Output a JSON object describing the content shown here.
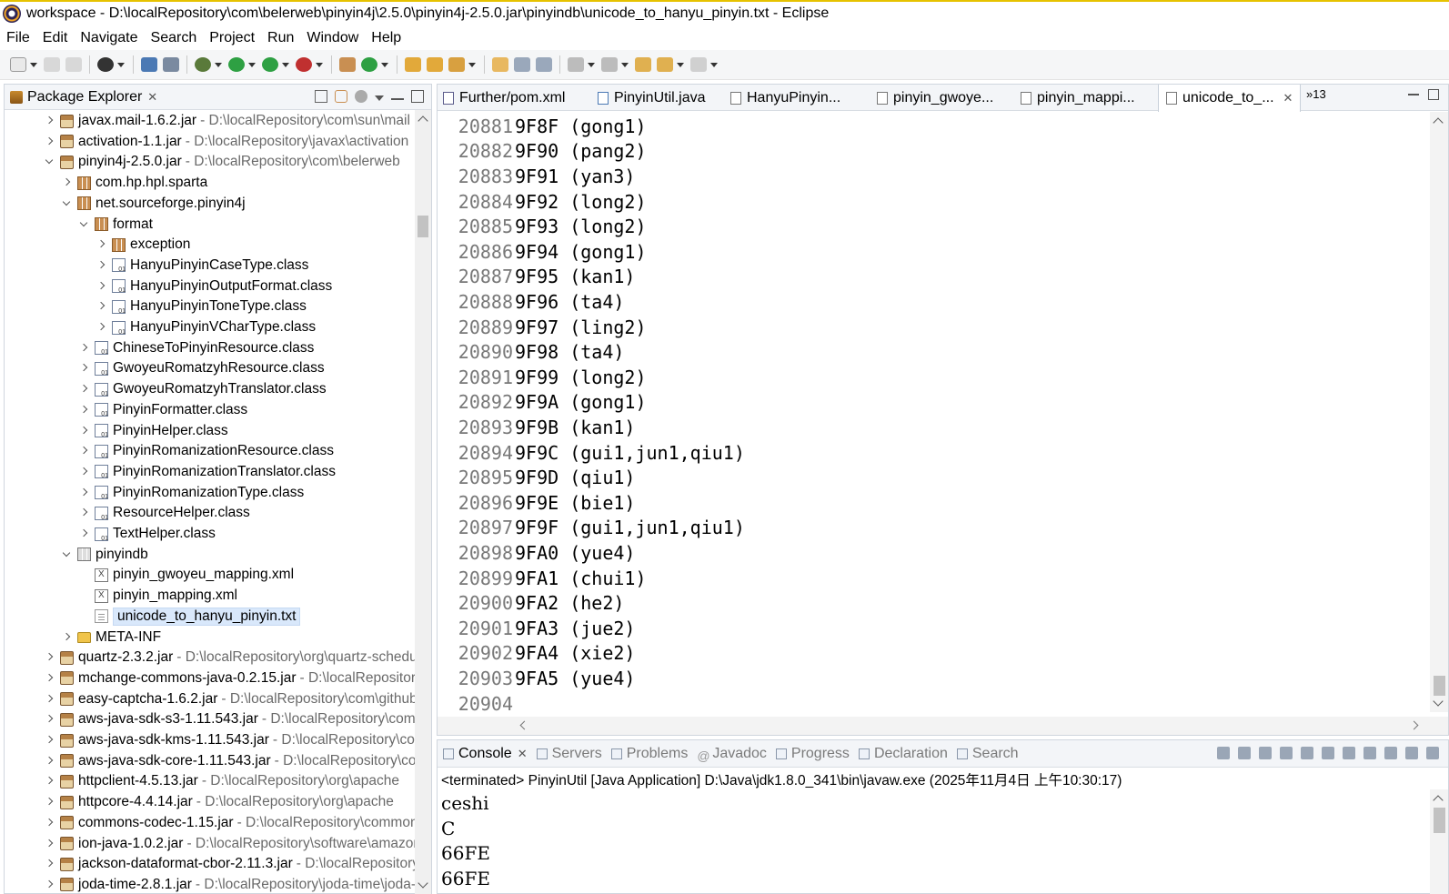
{
  "window": {
    "title": "workspace - D:\\localRepository\\com\\belerweb\\pinyin4j\\2.5.0\\pinyin4j-2.5.0.jar\\pinyindb\\unicode_to_hanyu_pinyin.txt - Eclipse"
  },
  "menu": [
    "File",
    "Edit",
    "Navigate",
    "Search",
    "Project",
    "Run",
    "Window",
    "Help"
  ],
  "package_explorer": {
    "title": "Package Explorer",
    "close": "✕",
    "rows": [
      {
        "indent": 0,
        "arrow": "right",
        "icon": "jar",
        "label": "javax.mail-1.6.2.jar",
        "path": "- D:\\localRepository\\com\\sun\\mail"
      },
      {
        "indent": 0,
        "arrow": "right",
        "icon": "jar",
        "label": "activation-1.1.jar",
        "path": "- D:\\localRepository\\javax\\activation"
      },
      {
        "indent": 0,
        "arrow": "down",
        "icon": "jar",
        "label": "pinyin4j-2.5.0.jar",
        "path": "- D:\\localRepository\\com\\belerweb"
      },
      {
        "indent": 1,
        "arrow": "right",
        "icon": "pkg",
        "label": "com.hp.hpl.sparta",
        "path": ""
      },
      {
        "indent": 1,
        "arrow": "down",
        "icon": "pkg",
        "label": "net.sourceforge.pinyin4j",
        "path": ""
      },
      {
        "indent": 2,
        "arrow": "down",
        "icon": "pkg",
        "label": "format",
        "path": ""
      },
      {
        "indent": 3,
        "arrow": "right",
        "icon": "pkg",
        "label": "exception",
        "path": ""
      },
      {
        "indent": 3,
        "arrow": "right",
        "icon": "cls",
        "label": "HanyuPinyinCaseType.class",
        "path": ""
      },
      {
        "indent": 3,
        "arrow": "right",
        "icon": "cls",
        "label": "HanyuPinyinOutputFormat.class",
        "path": ""
      },
      {
        "indent": 3,
        "arrow": "right",
        "icon": "cls",
        "label": "HanyuPinyinToneType.class",
        "path": ""
      },
      {
        "indent": 3,
        "arrow": "right",
        "icon": "cls",
        "label": "HanyuPinyinVCharType.class",
        "path": ""
      },
      {
        "indent": 2,
        "arrow": "right",
        "icon": "cls",
        "label": "ChineseToPinyinResource.class",
        "path": ""
      },
      {
        "indent": 2,
        "arrow": "right",
        "icon": "cls",
        "label": "GwoyeuRomatzyhResource.class",
        "path": ""
      },
      {
        "indent": 2,
        "arrow": "right",
        "icon": "cls",
        "label": "GwoyeuRomatzyhTranslator.class",
        "path": ""
      },
      {
        "indent": 2,
        "arrow": "right",
        "icon": "cls",
        "label": "PinyinFormatter.class",
        "path": ""
      },
      {
        "indent": 2,
        "arrow": "right",
        "icon": "cls",
        "label": "PinyinHelper.class",
        "path": ""
      },
      {
        "indent": 2,
        "arrow": "right",
        "icon": "cls",
        "label": "PinyinRomanizationResource.class",
        "path": ""
      },
      {
        "indent": 2,
        "arrow": "right",
        "icon": "cls",
        "label": "PinyinRomanizationTranslator.class",
        "path": ""
      },
      {
        "indent": 2,
        "arrow": "right",
        "icon": "cls",
        "label": "PinyinRomanizationType.class",
        "path": ""
      },
      {
        "indent": 2,
        "arrow": "right",
        "icon": "cls",
        "label": "ResourceHelper.class",
        "path": ""
      },
      {
        "indent": 2,
        "arrow": "right",
        "icon": "cls",
        "label": "TextHelper.class",
        "path": ""
      },
      {
        "indent": 1,
        "arrow": "down",
        "icon": "pkgfolder",
        "label": "pinyindb",
        "path": ""
      },
      {
        "indent": 2,
        "arrow": "none",
        "icon": "xml",
        "label": "pinyin_gwoyeu_mapping.xml",
        "path": ""
      },
      {
        "indent": 2,
        "arrow": "none",
        "icon": "xml",
        "label": "pinyin_mapping.xml",
        "path": ""
      },
      {
        "indent": 2,
        "arrow": "none",
        "icon": "txt",
        "label": "unicode_to_hanyu_pinyin.txt",
        "path": "",
        "selected": true
      },
      {
        "indent": 1,
        "arrow": "right",
        "icon": "folder",
        "label": "META-INF",
        "path": ""
      },
      {
        "indent": 0,
        "arrow": "right",
        "icon": "jar",
        "label": "quartz-2.3.2.jar",
        "path": "- D:\\localRepository\\org\\quartz-scheduler"
      },
      {
        "indent": 0,
        "arrow": "right",
        "icon": "jar",
        "label": "mchange-commons-java-0.2.15.jar",
        "path": "- D:\\localRepository"
      },
      {
        "indent": 0,
        "arrow": "right",
        "icon": "jar",
        "label": "easy-captcha-1.6.2.jar",
        "path": "- D:\\localRepository\\com\\github"
      },
      {
        "indent": 0,
        "arrow": "right",
        "icon": "jar",
        "label": "aws-java-sdk-s3-1.11.543.jar",
        "path": "- D:\\localRepository\\com"
      },
      {
        "indent": 0,
        "arrow": "right",
        "icon": "jar",
        "label": "aws-java-sdk-kms-1.11.543.jar",
        "path": "- D:\\localRepository\\com"
      },
      {
        "indent": 0,
        "arrow": "right",
        "icon": "jar",
        "label": "aws-java-sdk-core-1.11.543.jar",
        "path": "- D:\\localRepository\\com"
      },
      {
        "indent": 0,
        "arrow": "right",
        "icon": "jar",
        "label": "httpclient-4.5.13.jar",
        "path": "- D:\\localRepository\\org\\apache"
      },
      {
        "indent": 0,
        "arrow": "right",
        "icon": "jar",
        "label": "httpcore-4.4.14.jar",
        "path": "- D:\\localRepository\\org\\apache"
      },
      {
        "indent": 0,
        "arrow": "right",
        "icon": "jar",
        "label": "commons-codec-1.15.jar",
        "path": "- D:\\localRepository\\commons"
      },
      {
        "indent": 0,
        "arrow": "right",
        "icon": "jar",
        "label": "ion-java-1.0.2.jar",
        "path": "- D:\\localRepository\\software\\amazon"
      },
      {
        "indent": 0,
        "arrow": "right",
        "icon": "jar",
        "label": "jackson-dataformat-cbor-2.11.3.jar",
        "path": "- D:\\localRepository"
      },
      {
        "indent": 0,
        "arrow": "right",
        "icon": "jar",
        "label": "joda-time-2.8.1.jar",
        "path": "- D:\\localRepository\\joda-time\\joda-time"
      }
    ]
  },
  "editor": {
    "tabs": [
      {
        "label": "Further/pom.xml",
        "active": false
      },
      {
        "label": "PinyinUtil.java",
        "active": false
      },
      {
        "label": "HanyuPinyin...",
        "active": false
      },
      {
        "label": "pinyin_gwoye...",
        "active": false
      },
      {
        "label": "pinyin_mappi...",
        "active": false
      },
      {
        "label": "unicode_to_...",
        "active": true
      }
    ],
    "more_tabs": "»13",
    "lines": [
      {
        "num": "20881",
        "text": "9F8F (gong1)"
      },
      {
        "num": "20882",
        "text": "9F90 (pang2)"
      },
      {
        "num": "20883",
        "text": "9F91 (yan3)"
      },
      {
        "num": "20884",
        "text": "9F92 (long2)"
      },
      {
        "num": "20885",
        "text": "9F93 (long2)"
      },
      {
        "num": "20886",
        "text": "9F94 (gong1)"
      },
      {
        "num": "20887",
        "text": "9F95 (kan1)"
      },
      {
        "num": "20888",
        "text": "9F96 (ta4)"
      },
      {
        "num": "20889",
        "text": "9F97 (ling2)"
      },
      {
        "num": "20890",
        "text": "9F98 (ta4)"
      },
      {
        "num": "20891",
        "text": "9F99 (long2)"
      },
      {
        "num": "20892",
        "text": "9F9A (gong1)"
      },
      {
        "num": "20893",
        "text": "9F9B (kan1)"
      },
      {
        "num": "20894",
        "text": "9F9C (gui1,jun1,qiu1)"
      },
      {
        "num": "20895",
        "text": "9F9D (qiu1)"
      },
      {
        "num": "20896",
        "text": "9F9E (bie1)"
      },
      {
        "num": "20897",
        "text": "9F9F (gui1,jun1,qiu1)"
      },
      {
        "num": "20898",
        "text": "9FA0 (yue4)"
      },
      {
        "num": "20899",
        "text": "9FA1 (chui1)"
      },
      {
        "num": "20900",
        "text": "9FA2 (he2)"
      },
      {
        "num": "20901",
        "text": "9FA3 (jue2)"
      },
      {
        "num": "20902",
        "text": "9FA4 (xie2)"
      },
      {
        "num": "20903",
        "text": "9FA5 (yue4)"
      },
      {
        "num": "20904",
        "text": ""
      }
    ]
  },
  "console": {
    "tabs": [
      "Console",
      "Servers",
      "Problems",
      "Javadoc",
      "Progress",
      "Declaration",
      "Search"
    ],
    "close": "✕",
    "status": "<terminated> PinyinUtil [Java Application] D:\\Java\\jdk1.8.0_341\\bin\\javaw.exe (2025年11月4日 上午10:30:17)",
    "output": [
      "ceshi",
      "C",
      "66FE",
      "66FE"
    ]
  }
}
